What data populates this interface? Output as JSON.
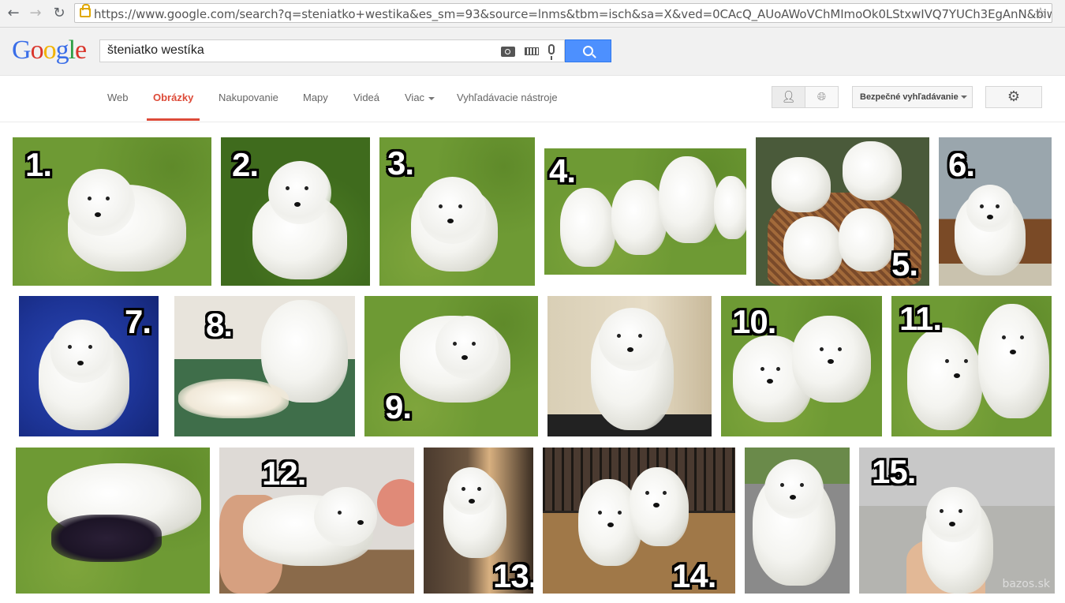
{
  "browser": {
    "url": "https://www.google.com/search?q=steniatko+westika&es_sm=93&source=lnms&tbm=isch&sa=X&ved=0CAcQ_AUoAWoVChMImoOk0LStxwIVQ7YUCh3EgAnN&biw=1"
  },
  "logo": [
    "G",
    "o",
    "o",
    "g",
    "l",
    "e"
  ],
  "search": {
    "query": "šteniatko westíka"
  },
  "tabs": [
    {
      "label": "Web"
    },
    {
      "label": "Obrázky"
    },
    {
      "label": "Nakupovanie"
    },
    {
      "label": "Mapy"
    },
    {
      "label": "Videá"
    },
    {
      "label": "Viac"
    },
    {
      "label": "Vyhľadávacie nástroje"
    }
  ],
  "toolbar": {
    "safesearch_label": "Bezpečné vyhľadávanie"
  },
  "images": [
    {
      "label": "1."
    },
    {
      "label": "2."
    },
    {
      "label": "3."
    },
    {
      "label": "4."
    },
    {
      "label": "5."
    },
    {
      "label": "6."
    },
    {
      "label": "7."
    },
    {
      "label": "8."
    },
    {
      "label": "9."
    },
    {
      "label": ""
    },
    {
      "label": "10."
    },
    {
      "label": "11."
    },
    {
      "label": ""
    },
    {
      "label": "12."
    },
    {
      "label": "13."
    },
    {
      "label": "14."
    },
    {
      "label": ""
    },
    {
      "label": "15."
    }
  ],
  "watermark": "bazos.sk"
}
